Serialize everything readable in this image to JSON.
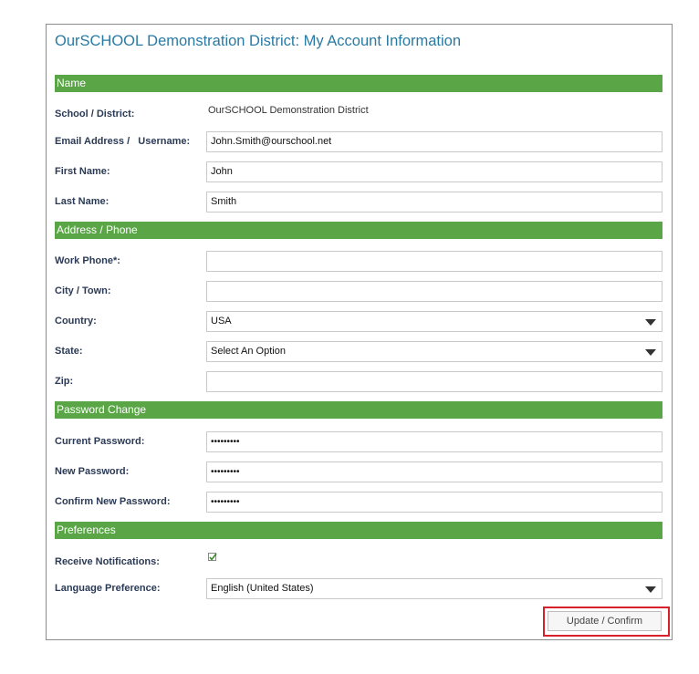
{
  "page": {
    "title": "OurSCHOOL Demonstration District: My Account Information"
  },
  "sections": {
    "name": "Name",
    "address": "Address / Phone",
    "password": "Password Change",
    "preferences": "Preferences"
  },
  "fields": {
    "school": {
      "label": "School / District:",
      "value": "OurSCHOOL Demonstration District"
    },
    "email": {
      "label": "Email Address /   Username:",
      "value": "John.Smith@ourschool.net"
    },
    "first_name": {
      "label": "First Name:",
      "value": "John"
    },
    "last_name": {
      "label": "Last Name:",
      "value": "Smith"
    },
    "work_phone": {
      "label": "Work Phone*:",
      "value": ""
    },
    "city": {
      "label": "City / Town:",
      "value": ""
    },
    "country": {
      "label": "Country:",
      "value": "USA"
    },
    "state": {
      "label": "State:",
      "value": "Select An Option"
    },
    "zip": {
      "label": "Zip:",
      "value": ""
    },
    "current_password": {
      "label": "Current Password:",
      "value": "•••••••••"
    },
    "new_password": {
      "label": "New Password:",
      "value": "•••••••••"
    },
    "confirm_password": {
      "label": "Confirm New Password:",
      "value": "•••••••••"
    },
    "notifications": {
      "label": "Receive Notifications:",
      "checked": true
    },
    "language": {
      "label": "Language Preference:",
      "value": "English (United States)"
    }
  },
  "buttons": {
    "update": "Update / Confirm"
  },
  "colors": {
    "section_bg": "#5aa646",
    "title": "#2a7aa3",
    "highlight": "#d8202a"
  }
}
